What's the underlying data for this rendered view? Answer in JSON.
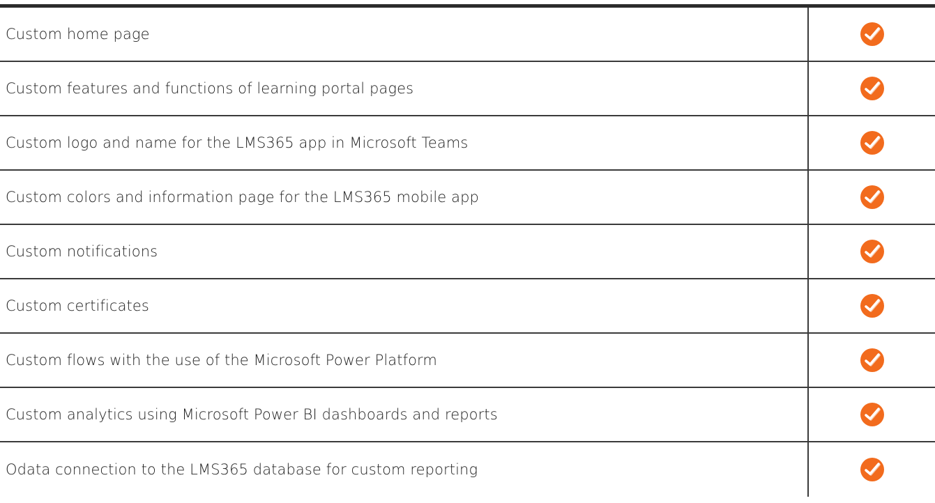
{
  "features": [
    {
      "label": "Custom home page",
      "included_icon": "check-icon"
    },
    {
      "label": "Custom features and functions of learning portal pages",
      "included_icon": "check-icon"
    },
    {
      "label": "Custom logo and name for the LMS365 app in Microsoft Teams",
      "included_icon": "check-icon"
    },
    {
      "label": "Custom colors and information page for the LMS365 mobile app",
      "included_icon": "check-icon"
    },
    {
      "label": "Custom notifications",
      "included_icon": "check-icon"
    },
    {
      "label": "Custom certificates",
      "included_icon": "check-icon"
    },
    {
      "label": "Custom flows with the use of the Microsoft Power Platform",
      "included_icon": "check-icon"
    },
    {
      "label": "Custom analytics using Microsoft Power BI dashboards and reports",
      "included_icon": "check-icon"
    },
    {
      "label": "Odata connection to the LMS365 database for custom reporting",
      "included_icon": "check-icon"
    }
  ],
  "colors": {
    "check_fill": "#f26b1d",
    "check_mark": "#ffffff",
    "check_shadow": "#f7c3a3",
    "text": "#222222",
    "rule": "#2b2b2b"
  }
}
